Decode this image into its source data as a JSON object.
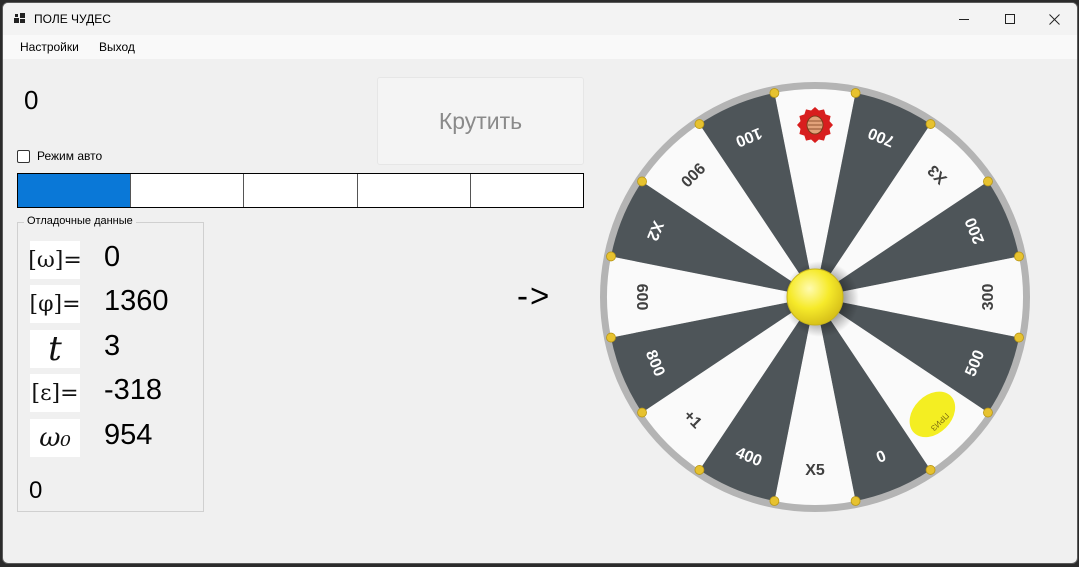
{
  "window": {
    "title": "ПОЛЕ ЧУДЕС",
    "minimize_glyph": "—",
    "maximize_glyph": "☐",
    "close_glyph": "✕"
  },
  "menu": [
    {
      "label": "Настройки"
    },
    {
      "label": "Выход"
    }
  ],
  "score_top": "0",
  "spin_button": {
    "label": "Крутить"
  },
  "auto_mode": {
    "label": "Режим авто",
    "checked": false
  },
  "progress": {
    "segments": 5,
    "filled": 1
  },
  "debug": {
    "title": "Отладочные данные",
    "rows": [
      {
        "symbol": "[ω]=",
        "value": "0"
      },
      {
        "symbol": "[φ]=",
        "value": "1360"
      },
      {
        "symbol": "t",
        "value": "3"
      },
      {
        "symbol": "[ε]=",
        "value": "-318"
      },
      {
        "symbol": "ω₀",
        "value": "954"
      }
    ]
  },
  "score_bottom": "0",
  "pointer": "->",
  "wheel": {
    "rotation_deg": 0,
    "colors": {
      "dark": "#4e5559",
      "light": "#fafafa",
      "rim": "#b4b4b4",
      "hub": "#f6ea2a",
      "peg": "#e7c22f"
    },
    "sectors": [
      {
        "label": "icon:fist",
        "color": "light"
      },
      {
        "label": "700",
        "color": "dark"
      },
      {
        "label": "X3",
        "color": "light"
      },
      {
        "label": "200",
        "color": "dark"
      },
      {
        "label": "300",
        "color": "light"
      },
      {
        "label": "500",
        "color": "dark"
      },
      {
        "label": "icon:prize",
        "color": "light"
      },
      {
        "label": "0",
        "color": "dark"
      },
      {
        "label": "X5",
        "color": "light"
      },
      {
        "label": "400",
        "color": "dark"
      },
      {
        "label": "+1",
        "color": "light"
      },
      {
        "label": "800",
        "color": "dark"
      },
      {
        "label": "600",
        "color": "light"
      },
      {
        "label": "X2",
        "color": "dark"
      },
      {
        "label": "900",
        "color": "light"
      },
      {
        "label": "100",
        "color": "dark"
      }
    ],
    "prize_text": "ПРИЗ"
  }
}
